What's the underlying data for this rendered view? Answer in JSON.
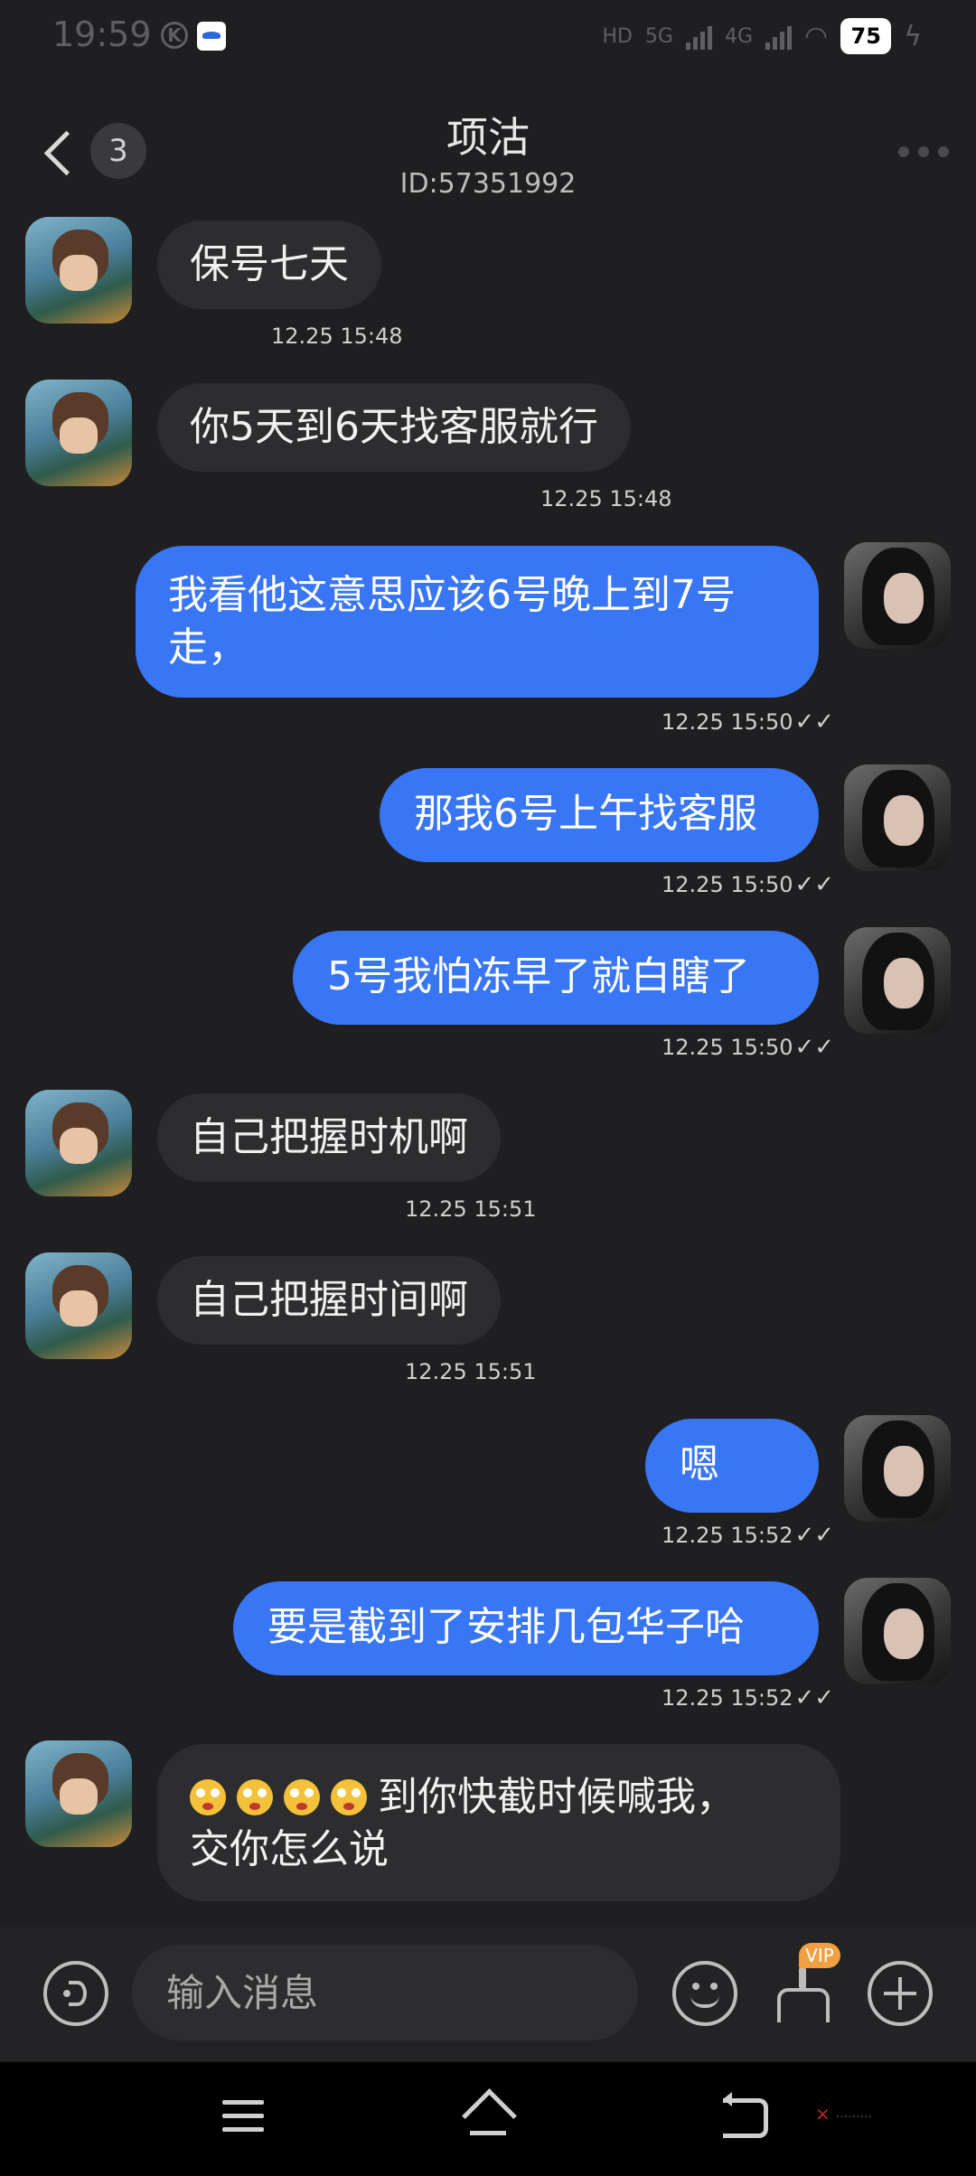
{
  "status_bar": {
    "time": "19:59",
    "k_icon": "K",
    "battery": "75",
    "network_1": "HD",
    "network_2": "5G",
    "network_3": "4G"
  },
  "header": {
    "unread_count": "3",
    "title": "项沽",
    "user_id": "ID:57351992"
  },
  "messages": [
    {
      "side": "in",
      "text": "保号七天",
      "time": "12.25 15:48"
    },
    {
      "side": "in",
      "text": "你5天到6天找客服就行",
      "time": "12.25 15:48"
    },
    {
      "side": "out",
      "text": "我看他这意思应该6号晚上到7号走，",
      "time": "12.25 15:50"
    },
    {
      "side": "out",
      "text": "那我6号上午找客服",
      "time": "12.25 15:50"
    },
    {
      "side": "out",
      "text": "5号我怕冻早了就白瞎了",
      "time": "12.25 15:50"
    },
    {
      "side": "in",
      "text": "自己把握时机啊",
      "time": "12.25 15:51"
    },
    {
      "side": "in",
      "text": "自己把握时间啊",
      "time": "12.25 15:51"
    },
    {
      "side": "out",
      "text": "嗯",
      "time": "12.25 15:52"
    },
    {
      "side": "out",
      "text": "要是截到了安排几包华子哈",
      "time": "12.25 15:52"
    },
    {
      "side": "in",
      "text_line1": "到你快截时候喊我，",
      "text_line2": "交你怎么说",
      "emoji_count": 4
    }
  ],
  "read_check": "✓✓",
  "input": {
    "placeholder": "输入消息",
    "vip_badge": "VIP"
  },
  "icons": {
    "back": "chevron-left-icon",
    "more": "more-dots-icon",
    "voice": "voice-icon",
    "emoji": "smile-icon",
    "clean": "broom-icon",
    "plus": "plus-icon"
  },
  "colors": {
    "outgoing_bubble": "#3876f5",
    "incoming_bubble": "#2d2d30",
    "background": "#1f1f21"
  }
}
